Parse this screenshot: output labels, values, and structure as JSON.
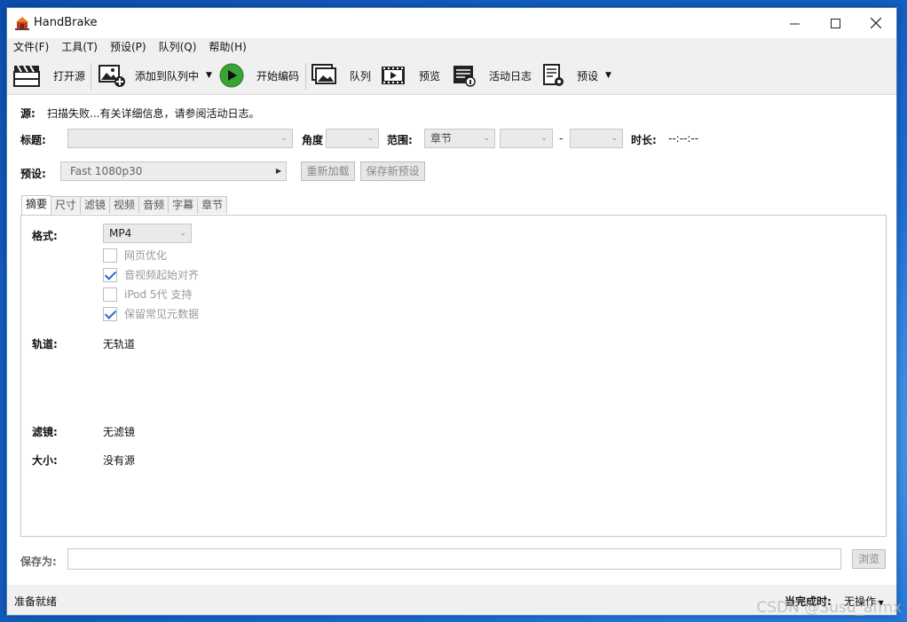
{
  "window": {
    "title": "HandBrake"
  },
  "menu": [
    "文件(F)",
    "工具(T)",
    "预设(P)",
    "队列(Q)",
    "帮助(H)"
  ],
  "toolbar": {
    "open_source": "打开源",
    "add_to_queue": "添加到队列中",
    "start_encode": "开始编码",
    "queue": "队列",
    "preview": "预览",
    "activity_log": "活动日志",
    "presets": "预设"
  },
  "source": {
    "label": "源:",
    "status": "扫描失败...有关详细信息，请参阅活动日志。"
  },
  "title_row": {
    "title_label": "标题:",
    "angle_label": "角度",
    "range_label": "范围:",
    "range_value": "章节",
    "range_dash": "-",
    "duration_label": "时长:",
    "duration_value": "--:--:--"
  },
  "preset_row": {
    "label": "预设:",
    "value": "Fast 1080p30",
    "reload": "重新加载",
    "save_new": "保存新预设"
  },
  "tabs": [
    "摘要",
    "尺寸",
    "滤镜",
    "视频",
    "音频",
    "字幕",
    "章节"
  ],
  "summary": {
    "format_label": "格式:",
    "format_value": "MP4",
    "options": [
      {
        "label": "网页优化",
        "checked": false
      },
      {
        "label": "音视频起始对齐",
        "checked": true
      },
      {
        "label": "iPod 5代 支持",
        "checked": false
      },
      {
        "label": "保留常见元数据",
        "checked": true
      }
    ],
    "tracks_label": "轨道:",
    "tracks_value": "无轨道",
    "filters_label": "滤镜:",
    "filters_value": "无滤镜",
    "size_label": "大小:",
    "size_value": "没有源"
  },
  "save": {
    "label": "保存为:",
    "browse": "浏览"
  },
  "status": {
    "left": "准备就绪",
    "when_done_label": "当完成时:",
    "when_done_value": "无操作"
  },
  "watermark": "CSDN @Susu_afmx"
}
